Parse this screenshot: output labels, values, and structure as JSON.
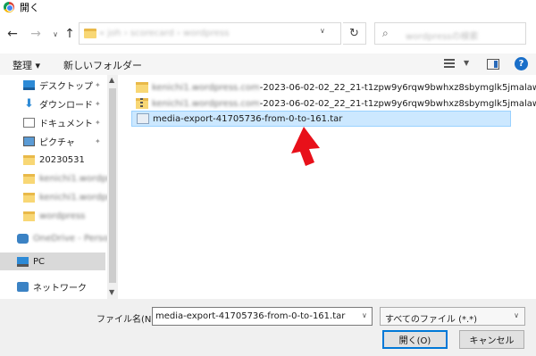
{
  "window": {
    "title": "開く"
  },
  "nav": {
    "address_path": "« ​joh › ​scorecard › ​wordpress",
    "search_placeholder": "wordpressの検索"
  },
  "toolbar": {
    "organize_label": "整理 ▾",
    "new_folder_label": "新しいフォルダー"
  },
  "sidebar": {
    "items": [
      {
        "label": "デスクトップ",
        "icon": "desktop-icon",
        "pinned": true
      },
      {
        "label": "ダウンロード",
        "icon": "download-icon",
        "pinned": true
      },
      {
        "label": "ドキュメント",
        "icon": "documents-icon",
        "pinned": true
      },
      {
        "label": "ピクチャ",
        "icon": "pictures-icon",
        "pinned": true
      },
      {
        "label": "20230531",
        "icon": "folder-icon"
      },
      {
        "label": "kenichi1.wordpre",
        "icon": "folder-icon",
        "blurred": true
      },
      {
        "label": "kenichi1.wordpr",
        "icon": "folder-icon",
        "blurred": true
      },
      {
        "label": "wordpress",
        "icon": "folder-icon",
        "blurred": true
      },
      {
        "label": "OneDrive - Person",
        "icon": "onedrive-icon",
        "blurred": true
      },
      {
        "label": "PC",
        "icon": "pc-icon",
        "selected": true
      },
      {
        "label": "ネットワーク",
        "icon": "network-icon"
      }
    ]
  },
  "files": [
    {
      "prefix": "kenichi1.wordpress.com",
      "name": "-2023-06-02-02_22_21-t1zpw9y6rqw9bwhxz8sbymglk5jmalaw",
      "icon": "folder-icon"
    },
    {
      "prefix": "kenichi1.wordpress.com",
      "name": "-2023-06-02-02_22_21-t1zpw9y6rqw9bwhxz8sbymglk5jmalaw.zip",
      "icon": "zip-icon"
    },
    {
      "prefix": "",
      "name": "media-export-41705736-from-0-to-161.tar",
      "icon": "tar-file-icon",
      "selected": true
    }
  ],
  "bottom": {
    "filename_label": "ファイル名(N):",
    "filename_value": "media-export-41705736-from-0-to-161.tar",
    "filetype_value": "すべてのファイル (*.*)",
    "open_label": "開く(O)",
    "cancel_label": "キャンセル"
  },
  "colors": {
    "selection": "#cce8ff",
    "accent": "#0078d7",
    "annotation_arrow": "#e8101a"
  }
}
